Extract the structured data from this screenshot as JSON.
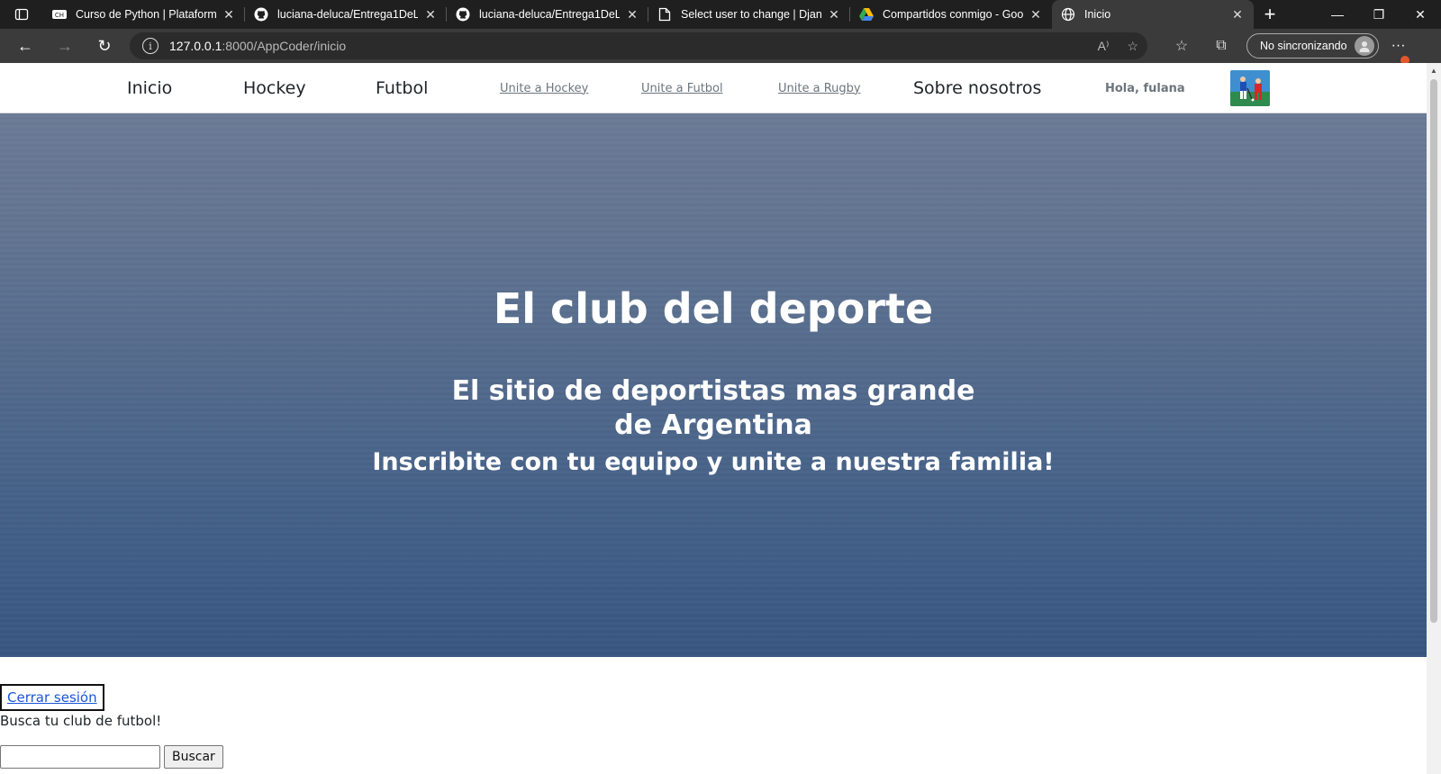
{
  "browser": {
    "tabs": [
      {
        "title": "Curso de Python | Plataforma",
        "icon": "coderhouse-icon"
      },
      {
        "title": "luciana-deluca/Entrega1DeLu",
        "icon": "github-icon"
      },
      {
        "title": "luciana-deluca/Entrega1DeLu",
        "icon": "github-icon"
      },
      {
        "title": "Select user to change | Djang",
        "icon": "page-icon"
      },
      {
        "title": "Compartidos conmigo - Goog",
        "icon": "google-drive-icon"
      },
      {
        "title": "Inicio",
        "icon": "globe-icon"
      }
    ],
    "url_host": "127.0.0.1",
    "url_path": ":8000/AppCoder/inicio",
    "profile_label": "No sincronizando"
  },
  "site": {
    "nav": {
      "inicio": "Inicio",
      "hockey": "Hockey",
      "futbol": "Futbol",
      "unite_hockey": "Unite a Hockey",
      "unite_futbol": "Unite a Futbol",
      "unite_rugby": "Unite a Rugby",
      "sobre": "Sobre nosotros",
      "greeting": "Hola, fulana"
    },
    "hero": {
      "title": "El club del deporte",
      "subtitle": "El sitio de deportistas mas grande de Argentina",
      "tagline": "Inscribite con tu equipo y unite a nuestra familia!"
    },
    "logout": "Cerrar sesión",
    "search_label": "Busca tu club de futbol!",
    "search_button": "Buscar"
  },
  "colors": {
    "chrome_dark": "#1f1f1f",
    "chrome_mid": "#3b3b3b",
    "hero_top": "#6a7a95",
    "hero_bottom": "#36557f",
    "link_blue": "#1a56d6"
  }
}
